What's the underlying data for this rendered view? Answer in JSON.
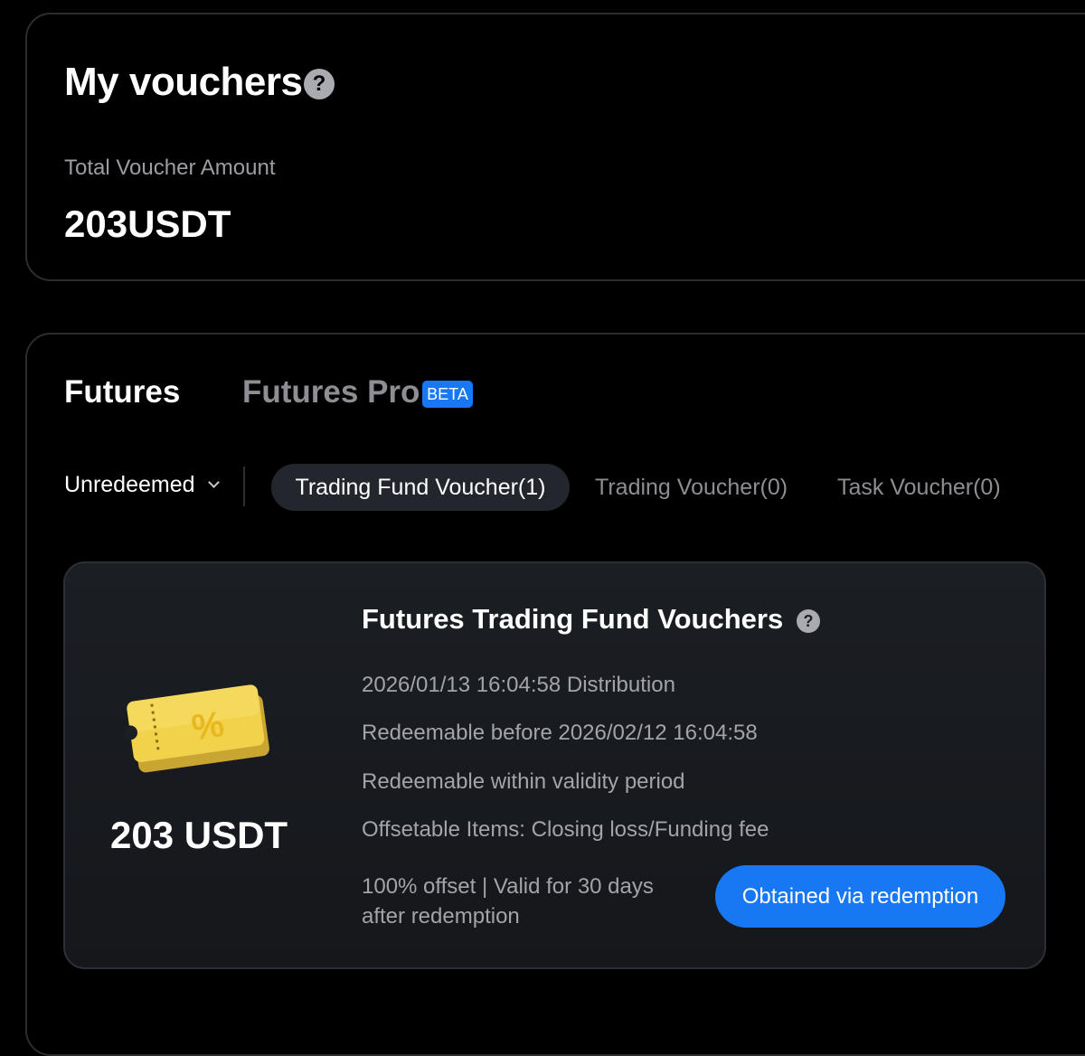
{
  "summary": {
    "title": "My vouchers",
    "help_glyph": "?",
    "total_label": "Total Voucher Amount",
    "total_value": "203USDT"
  },
  "product_tabs": [
    {
      "label": "Futures",
      "selected": true
    },
    {
      "label": "Futures Pro",
      "selected": false,
      "badge": "BETA"
    }
  ],
  "filters": {
    "status_label": "Unredeemed",
    "voucher_tabs": [
      {
        "label": "Trading Fund Voucher(1)",
        "selected": true
      },
      {
        "label": "Trading Voucher(0)",
        "selected": false
      },
      {
        "label": "Task Voucher(0)",
        "selected": false
      }
    ]
  },
  "voucher": {
    "amount": "203 USDT",
    "title": "Futures Trading Fund Vouchers",
    "help_glyph": "?",
    "ticket_symbol": "%",
    "details": [
      "2026/01/13 16:04:58 Distribution",
      "Redeemable before 2026/02/12 16:04:58",
      "Redeemable within validity period",
      "Offsetable Items: Closing loss/Funding fee"
    ],
    "offset_text": "100% offset | Valid for 30 days after redemption",
    "button_label": "Obtained via redemption"
  },
  "colors": {
    "background": "#000000",
    "accent_blue": "#1877f2",
    "card_bg": "#1b1e23",
    "muted_text": "#a2a4a9",
    "ticket_gold": "#f2d24a"
  },
  "icons": {
    "help": "question-circle-icon",
    "dropdown": "chevron-down-icon",
    "ticket": "voucher-ticket-icon"
  }
}
